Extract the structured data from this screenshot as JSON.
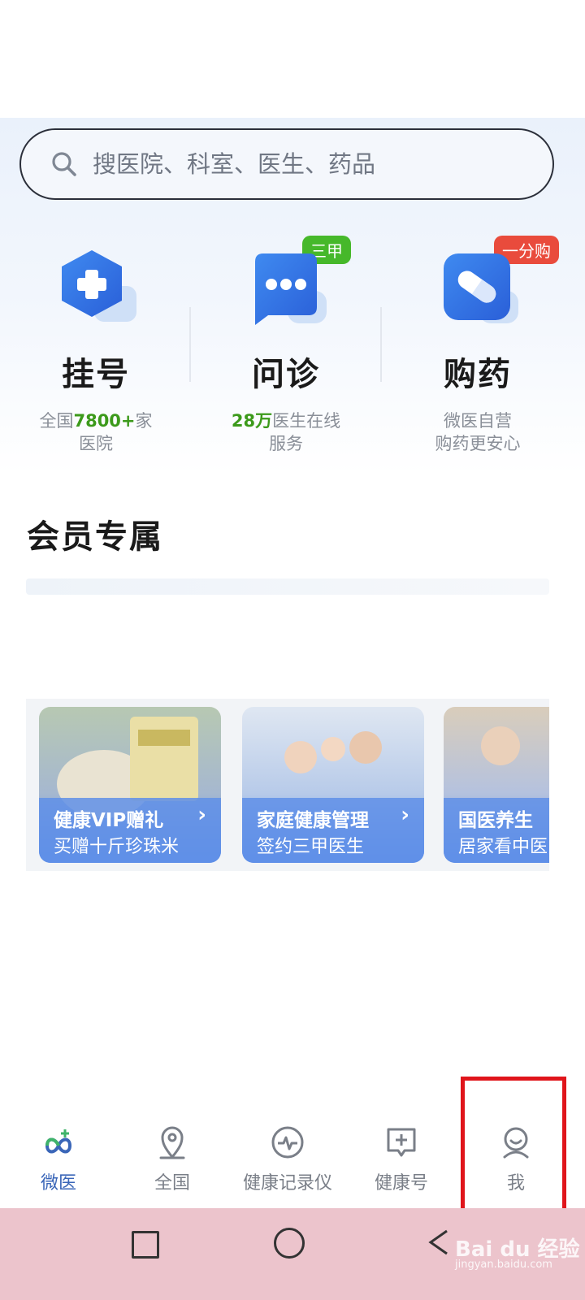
{
  "search": {
    "placeholder": "搜医院、科室、医生、药品"
  },
  "services": [
    {
      "title": "挂号",
      "sub_prefix": "全国",
      "sub_highlight": "7800+",
      "sub_suffix": "家",
      "sub_line2": "医院",
      "badge": ""
    },
    {
      "title": "问诊",
      "sub_prefix": "",
      "sub_highlight": "28万",
      "sub_suffix": "医生在线",
      "sub_line2": "服务",
      "badge": "三甲"
    },
    {
      "title": "购药",
      "sub_prefix": "微医自营",
      "sub_highlight": "",
      "sub_suffix": "",
      "sub_line2": "购药更安心",
      "badge": "一分购"
    }
  ],
  "member": {
    "title": "会员专属",
    "cards": [
      {
        "line1": "健康VIP赠礼",
        "line2": "买赠十斤珍珠米"
      },
      {
        "line1": "家庭健康管理",
        "line2": "签约三甲医生"
      },
      {
        "line1": "国医养生",
        "line2": "居家看中医"
      }
    ]
  },
  "tabbar": {
    "items": [
      {
        "label": "微医",
        "icon": "weiyi-logo-icon",
        "active": true
      },
      {
        "label": "全国",
        "icon": "location-pin-icon",
        "active": false
      },
      {
        "label": "健康记录仪",
        "icon": "heartbeat-icon",
        "active": false
      },
      {
        "label": "健康号",
        "icon": "health-post-icon",
        "active": false
      },
      {
        "label": "我",
        "icon": "profile-icon",
        "active": false
      }
    ]
  },
  "watermark": {
    "brand": "Bai du 经验",
    "url": "jingyan.baidu.com"
  },
  "colors": {
    "accent": "#3a66b8",
    "green": "#3c9a1b",
    "badge_green": "#46b82a",
    "badge_red": "#e94b3c",
    "highlight": "#e0151b"
  }
}
